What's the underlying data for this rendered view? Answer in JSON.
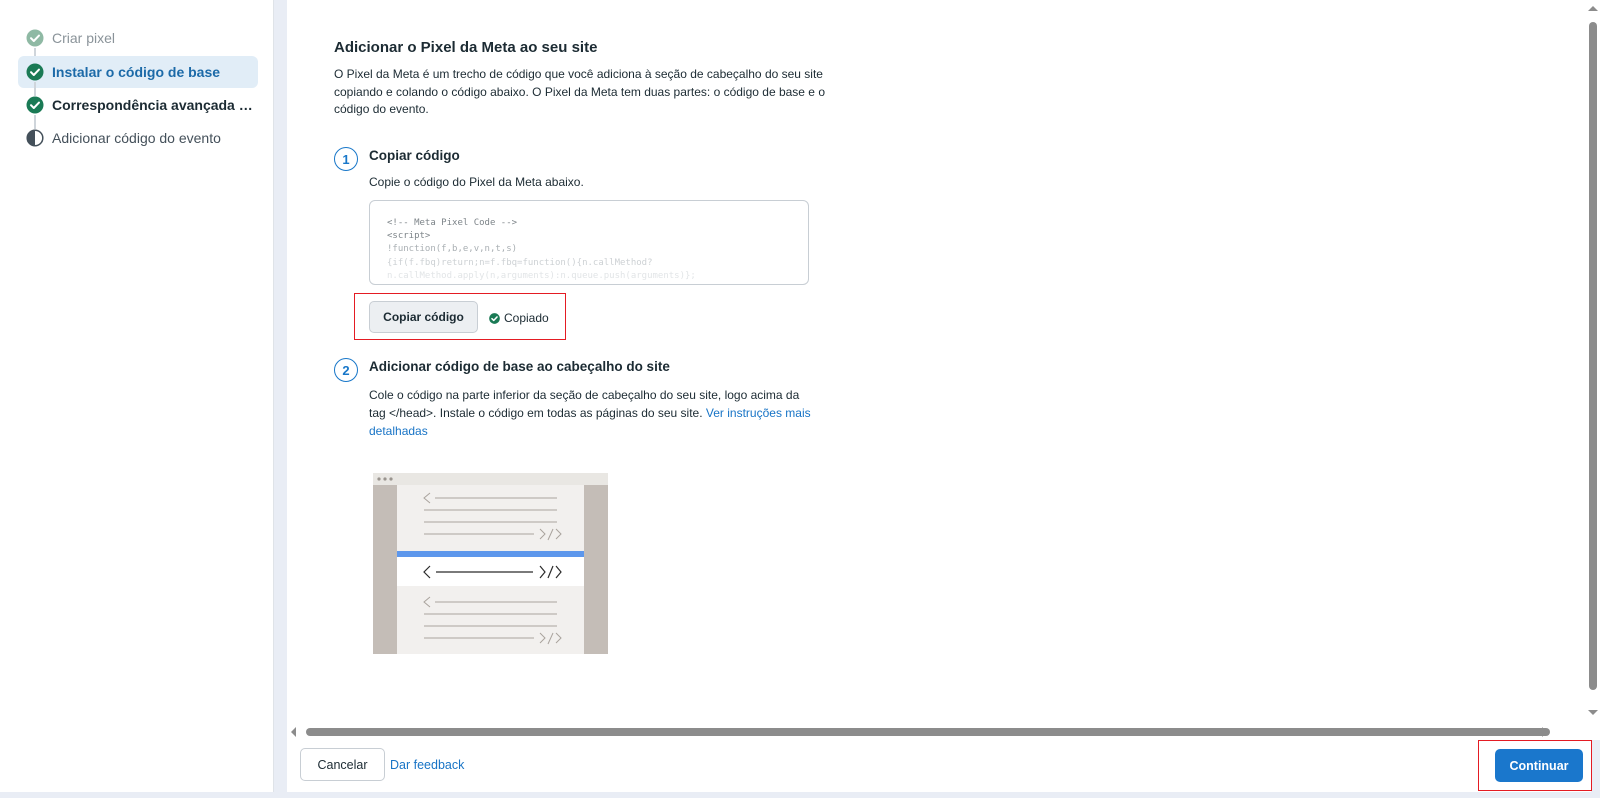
{
  "sidebar": {
    "steps": [
      {
        "label": "Criar pixel",
        "status": "done-faded"
      },
      {
        "label": "Instalar o código de base",
        "status": "active"
      },
      {
        "label": "Correspondência avançada a...",
        "status": "done"
      },
      {
        "label": "Adicionar código do evento",
        "status": "partial"
      }
    ]
  },
  "main": {
    "title": "Adicionar o Pixel da Meta ao seu site",
    "intro": "O Pixel da Meta é um trecho de código que você adiciona à seção de cabeçalho do seu site copiando e colando o código abaixo. O Pixel da Meta tem duas partes: o código de base e o código do evento.",
    "step1": {
      "number": "1",
      "title": "Copiar código",
      "description": "Copie o código do Pixel da Meta abaixo.",
      "code_lines": [
        "<!-- Meta Pixel Code -->",
        "<script>",
        "!function(f,b,e,v,n,t,s)",
        "{if(f.fbq)return;n=f.fbq=function(){n.callMethod?",
        "n.callMethod.apply(n,arguments):n.queue.push(arguments)};"
      ],
      "copy_button": "Copiar código",
      "copied_status": "Copiado"
    },
    "step2": {
      "number": "2",
      "title": "Adicionar código de base ao cabeçalho do site",
      "description": "Cole o código na parte inferior da seção de cabeçalho do seu site, logo acima da tag </head>. Instale o código em todas as páginas do seu site.",
      "link": "Ver instruções mais detalhadas"
    }
  },
  "footer": {
    "cancel": "Cancelar",
    "feedback": "Dar feedback",
    "continue": "Continuar"
  },
  "colors": {
    "accent": "#1a77cc",
    "success": "#1a7a55",
    "highlight": "#e41b23"
  }
}
